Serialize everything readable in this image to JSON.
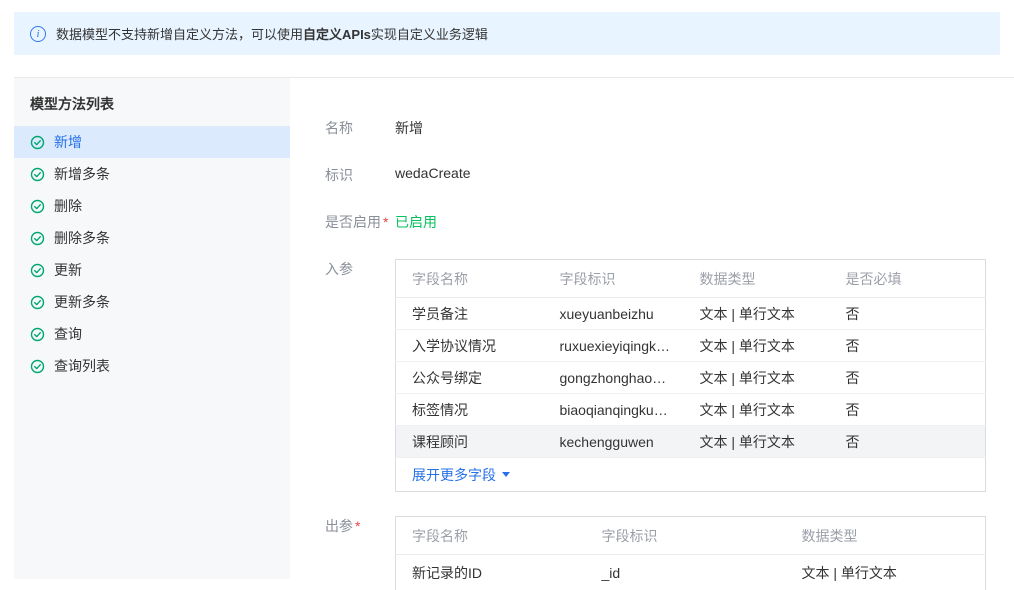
{
  "banner": {
    "info_glyph": "i",
    "text_before": "数据模型不支持新增自定义方法，可以使用",
    "text_bold": "自定义APIs",
    "text_after": "实现自定义业务逻辑"
  },
  "sidebar": {
    "title": "模型方法列表",
    "items": [
      {
        "label": "新增",
        "selected": true
      },
      {
        "label": "新增多条",
        "selected": false
      },
      {
        "label": "删除",
        "selected": false
      },
      {
        "label": "删除多条",
        "selected": false
      },
      {
        "label": "更新",
        "selected": false
      },
      {
        "label": "更新多条",
        "selected": false
      },
      {
        "label": "查询",
        "selected": false
      },
      {
        "label": "查询列表",
        "selected": false
      }
    ]
  },
  "detail": {
    "fields": [
      {
        "label": "名称",
        "value": "新增"
      },
      {
        "label": "标识",
        "value": "wedaCreate"
      },
      {
        "label": "是否启用",
        "required": "*",
        "value": "已启用"
      }
    ],
    "input_params": {
      "label": "入参",
      "columns": [
        "字段名称",
        "字段标识",
        "数据类型",
        "是否必填"
      ],
      "rows": [
        [
          "学员备注",
          "xueyuanbeizhu",
          "文本 | 单行文本",
          "否"
        ],
        [
          "入学协议情况",
          "ruxuexieyiqingkuang",
          "文本 | 单行文本",
          "否"
        ],
        [
          "公众号绑定",
          "gongzhonghaobangd...",
          "文本 | 单行文本",
          "否"
        ],
        [
          "标签情况",
          "biaoqianqingkuang",
          "文本 | 单行文本",
          "否"
        ],
        [
          "课程顾问",
          "kechengguwen",
          "文本 | 单行文本",
          "否"
        ]
      ],
      "expand_link": "展开更多字段"
    },
    "output_params": {
      "label": "出参",
      "required": "*",
      "columns": [
        "字段名称",
        "字段标识",
        "数据类型"
      ],
      "rows": [
        [
          "新记录的ID",
          "_id",
          "文本 | 单行文本"
        ]
      ]
    }
  },
  "colors": {
    "banner_bg": "#e8f4ff",
    "accent_blue": "#2670e8",
    "selected_bg": "#dbeafd",
    "sidebar_bg": "#f7f8fa",
    "enabled_green": "#07c160",
    "method_icon_teal": "#00a870",
    "required_red": "#e54545"
  }
}
